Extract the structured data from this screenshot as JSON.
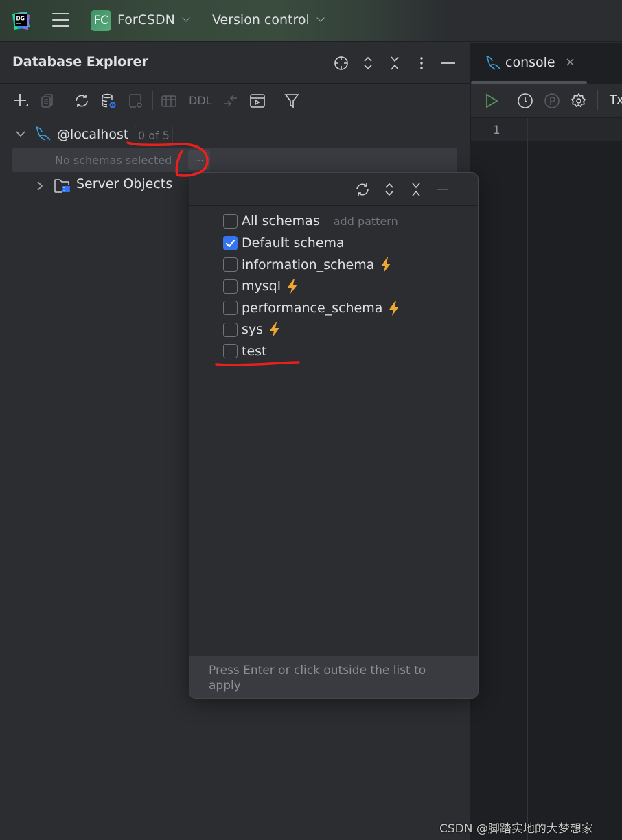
{
  "titlebar": {
    "app_icon": "datagrip-logo-icon",
    "menu_icon": "hamburger-menu-icon",
    "project_badge": "FC",
    "project_name": "ForCSDN",
    "vcs_label": "Version control"
  },
  "database_explorer": {
    "title": "Database Explorer",
    "header_icons": [
      "locate-icon",
      "expand-all-icon",
      "collapse-all-icon",
      "more-options-icon",
      "minimize-icon"
    ],
    "toolbar": {
      "items": [
        "add-icon",
        "duplicate-icon",
        "refresh-icon",
        "data-source-properties-icon",
        "jump-to-console-icon",
        "table-view-icon",
        "ddl",
        "compare-icon",
        "console-icon",
        "filter-icon"
      ],
      "ddl_label": "DDL"
    },
    "tree": {
      "host": {
        "label": "@localhost",
        "count_badge": "0 of 5",
        "schema_placeholder": "No schemas selected",
        "more_button": "..."
      },
      "server_objects": "Server Objects"
    }
  },
  "schema_popup": {
    "header_icons": [
      "refresh-icon",
      "expand-icon",
      "collapse-icon",
      "minimize-icon"
    ],
    "all_schemas": {
      "label": "All schemas",
      "checked": false,
      "add_pattern": "add pattern"
    },
    "schemas": [
      {
        "name": "Default schema",
        "checked": true,
        "introspect": false
      },
      {
        "name": "information_schema",
        "checked": false,
        "introspect": true
      },
      {
        "name": "mysql",
        "checked": false,
        "introspect": true
      },
      {
        "name": "performance_schema",
        "checked": false,
        "introspect": true
      },
      {
        "name": "sys",
        "checked": false,
        "introspect": true
      },
      {
        "name": "test",
        "checked": false,
        "introspect": false
      }
    ],
    "footer_hint": "Press Enter or click outside the list to apply"
  },
  "editor": {
    "tab": {
      "label": "console",
      "close": "×"
    },
    "toolbar": {
      "tx_label": "Tx"
    },
    "line_numbers": [
      "1"
    ]
  },
  "colors": {
    "accent": "#3574f0",
    "run_green": "#57965c",
    "bolt": "#f0a732",
    "annotation_red": "#e8201e",
    "mysql_blue": "#3e9fd8"
  },
  "watermark": "CSDN @脚踏实地的大梦想家"
}
